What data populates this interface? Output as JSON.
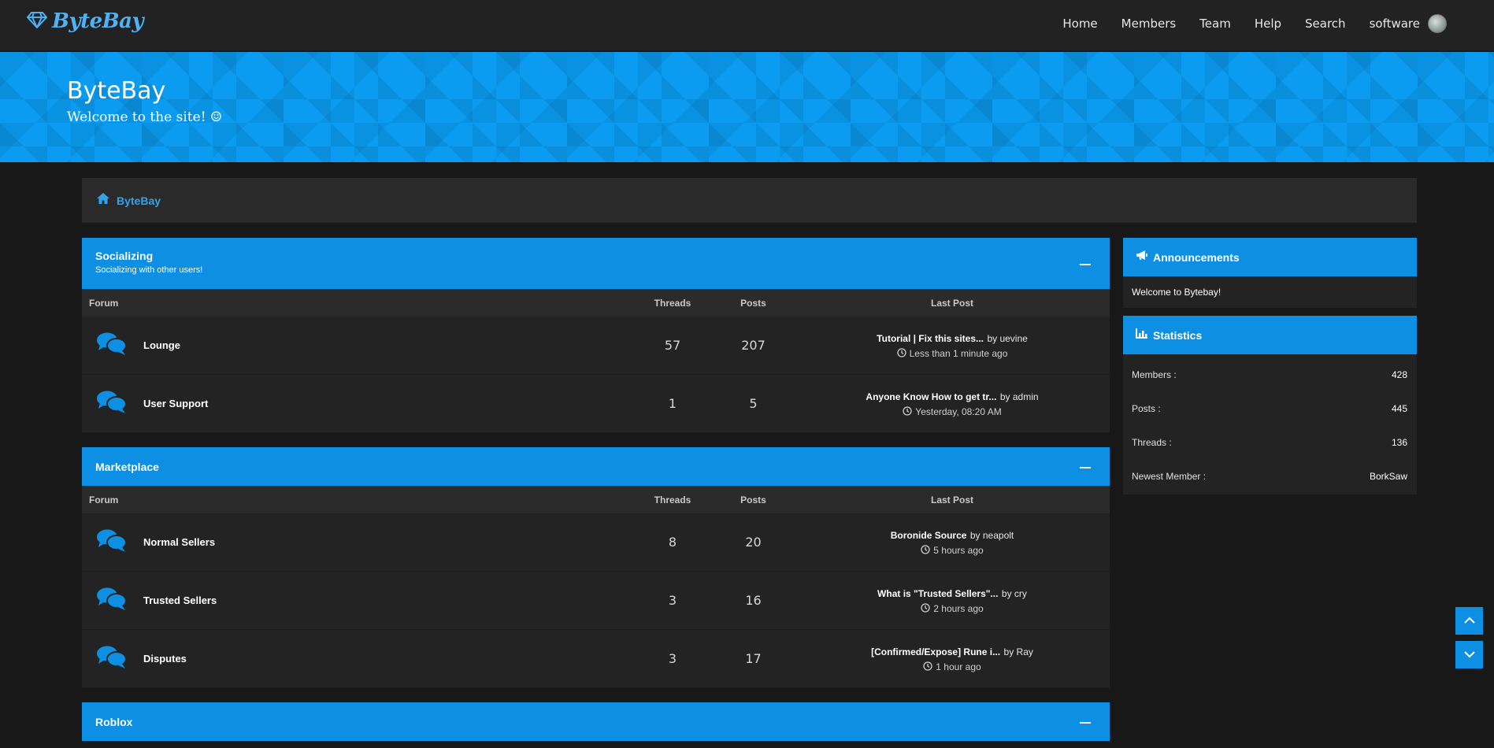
{
  "nav": {
    "logo": "ByteBay",
    "links": [
      "Home",
      "Members",
      "Team",
      "Help",
      "Search"
    ],
    "user": "software"
  },
  "banner": {
    "title": "ByteBay",
    "subtitle": "Welcome to the site! ☺"
  },
  "breadcrumb": {
    "label": "ByteBay"
  },
  "columns": {
    "forum": "Forum",
    "threads": "Threads",
    "posts": "Posts",
    "last_post": "Last Post"
  },
  "categories": [
    {
      "title": "Socializing",
      "description": "Socializing with other users!",
      "forums": [
        {
          "name": "Lounge",
          "threads": "57",
          "posts": "207",
          "last_title": "Tutorial | Fix this sites...",
          "last_by": "by uevine",
          "last_time": "Less than 1 minute ago"
        },
        {
          "name": "User Support",
          "threads": "1",
          "posts": "5",
          "last_title": "Anyone Know How to get tr...",
          "last_by": "by admin",
          "last_time": "Yesterday, 08:20 AM"
        }
      ]
    },
    {
      "title": "Marketplace",
      "description": "",
      "forums": [
        {
          "name": "Normal Sellers",
          "threads": "8",
          "posts": "20",
          "last_title": "Boronide Source",
          "last_by": "by neapolt",
          "last_time": "5 hours ago"
        },
        {
          "name": "Trusted Sellers",
          "threads": "3",
          "posts": "16",
          "last_title": "What is \"Trusted Sellers\"...",
          "last_by": "by cry",
          "last_time": "2 hours ago"
        },
        {
          "name": "Disputes",
          "threads": "3",
          "posts": "17",
          "last_title": "[Confirmed/Expose] Rune i...",
          "last_by": "by Ray",
          "last_time": "1 hour ago"
        }
      ]
    },
    {
      "title": "Roblox",
      "description": "",
      "forums": []
    }
  ],
  "sidebar": {
    "announcements": {
      "title": "Announcements",
      "text": "Welcome to Bytebay!"
    },
    "statistics": {
      "title": "Statistics",
      "rows": [
        {
          "label": "Members :",
          "value": "428"
        },
        {
          "label": "Posts :",
          "value": "445"
        },
        {
          "label": "Threads :",
          "value": "136"
        },
        {
          "label": "Newest Member :",
          "value": "BorkSaw"
        }
      ]
    }
  },
  "colors": {
    "accent": "#0d8fe3",
    "banner": "#0b9bf0",
    "nav_bg": "#222222",
    "page_bg": "#181818"
  }
}
